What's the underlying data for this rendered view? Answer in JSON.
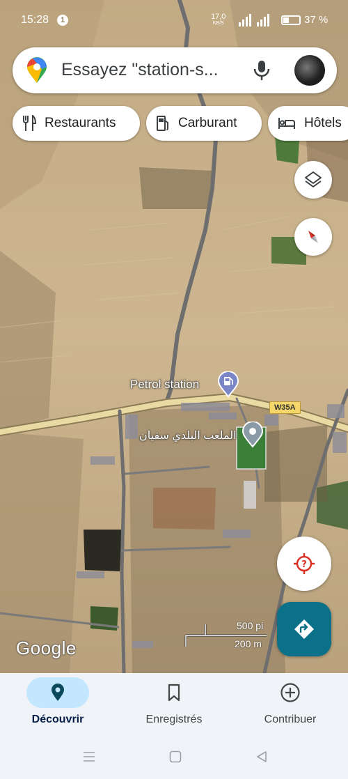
{
  "status_bar": {
    "time": "15:28",
    "notification_badge": "1",
    "network_speed": "17,0",
    "network_unit": "KB/S",
    "battery_percent": "37 %"
  },
  "search": {
    "placeholder": "Essayez \"station-s..."
  },
  "chips": {
    "restaurants": "Restaurants",
    "fuel": "Carburant",
    "hotels": "Hôtels"
  },
  "map": {
    "petrol_station_label": "Petrol station",
    "stadium_label": "الملعب البلدي سفيان",
    "road_shield": "W35A",
    "google_logo": "Google",
    "scale_imperial": "500 pi",
    "scale_metric": "200 m"
  },
  "bottom_nav": {
    "items": [
      {
        "label": "Découvrir",
        "icon": "location-pin-icon",
        "active": true
      },
      {
        "label": "Enregistrés",
        "icon": "bookmark-icon",
        "active": false
      },
      {
        "label": "Contribuer",
        "icon": "add-circle-icon",
        "active": false
      }
    ]
  },
  "colors": {
    "accent": "#0b7188",
    "active_pill": "#c2e7ff",
    "road_shield": "#f5d66a",
    "nav_background": "#f0f4f8"
  }
}
